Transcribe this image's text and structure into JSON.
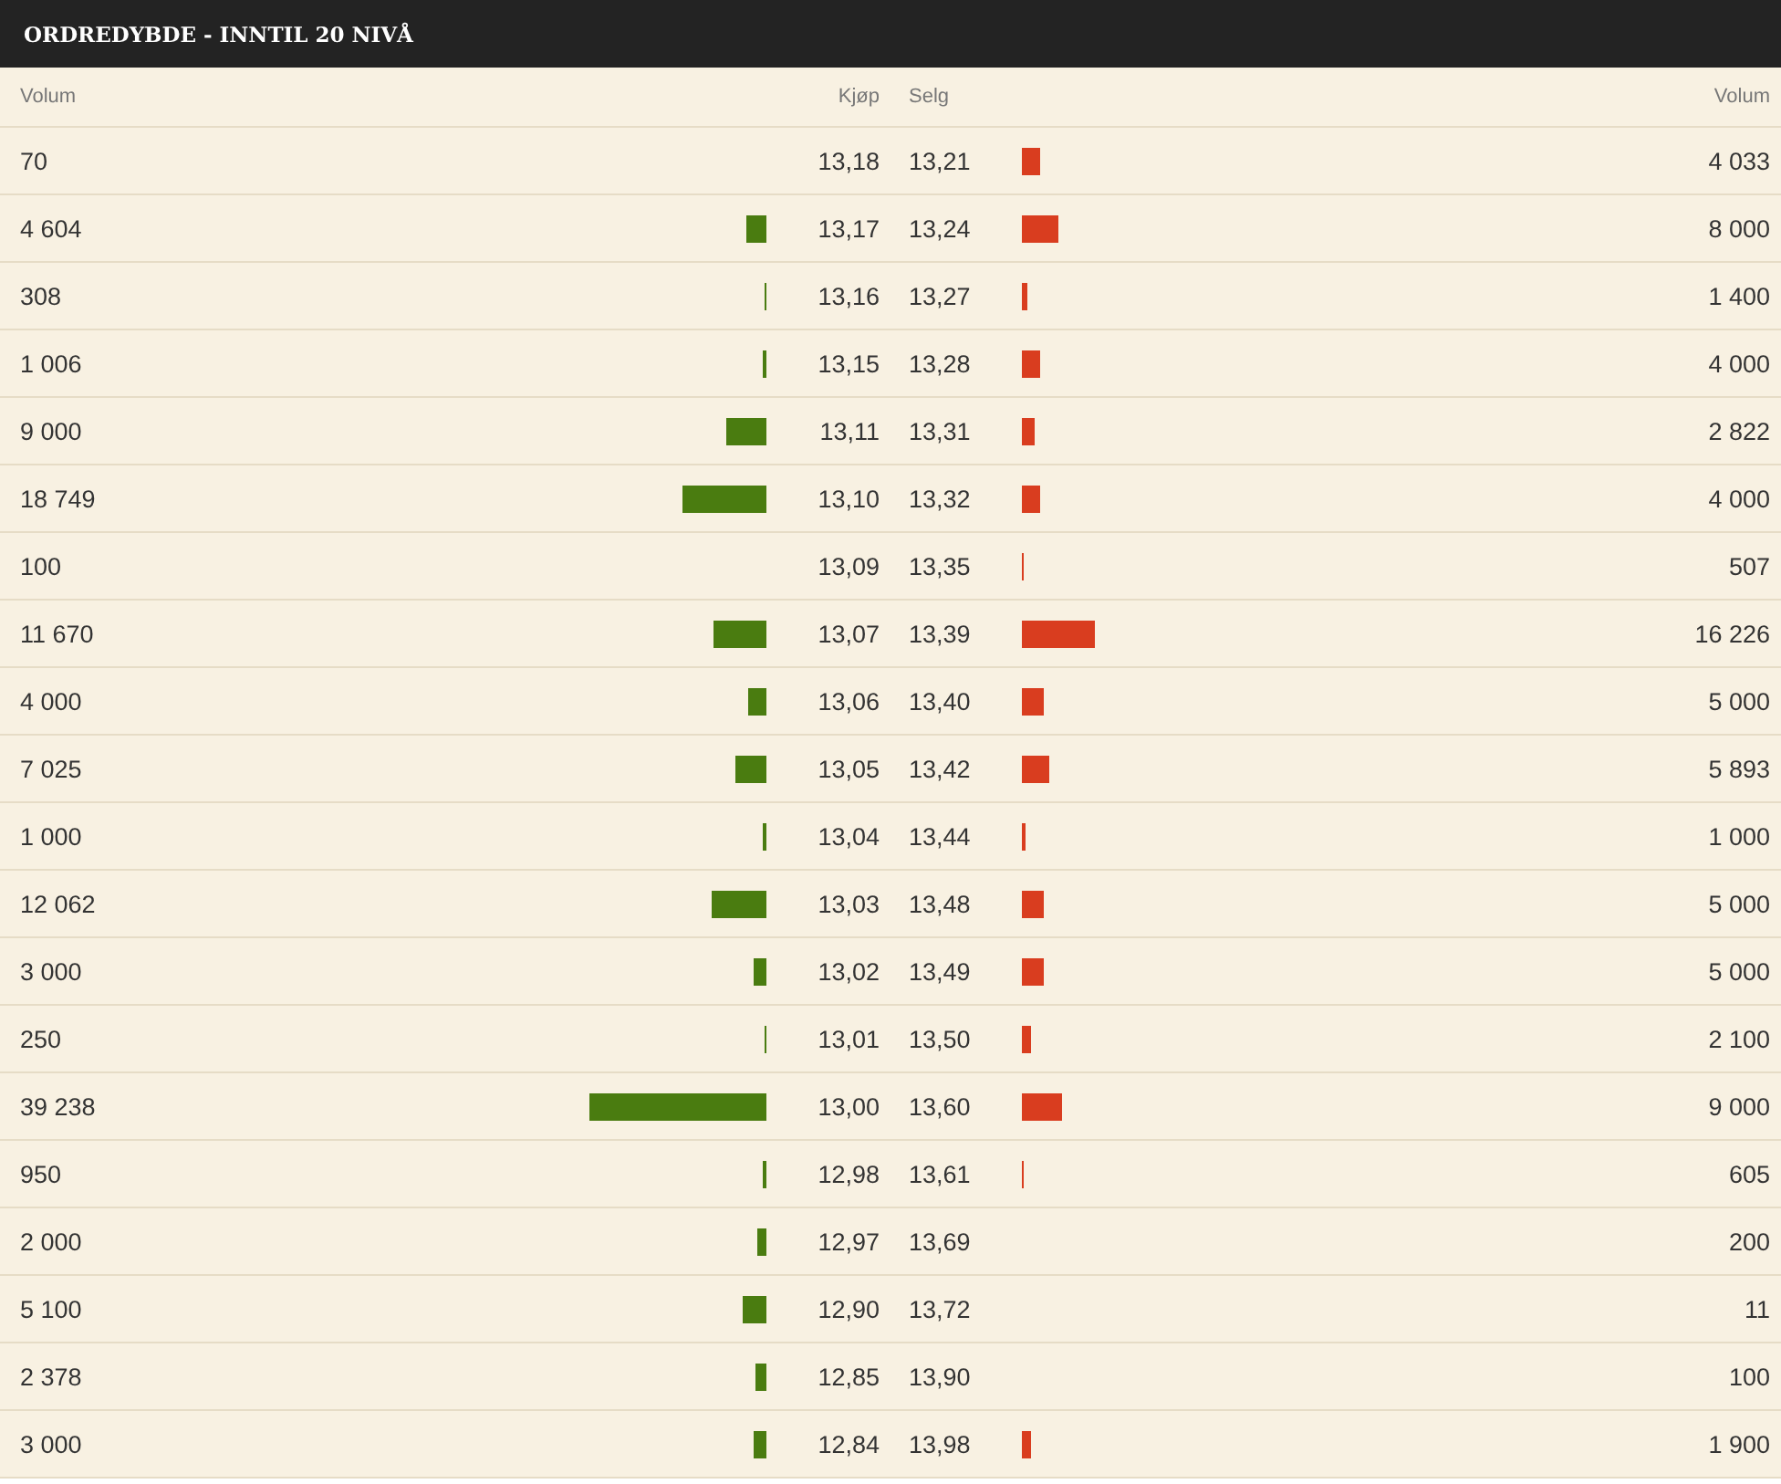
{
  "title": "ORDREDYBDE - INNTIL 20 NIVÅ",
  "columns": [
    "Volum",
    "Kjøp",
    "Selg",
    "Volum"
  ],
  "rows": [
    {
      "bid": {
        "volume": "70",
        "price": "13,18"
      },
      "ask": {
        "price": "13,21",
        "level": 0.1,
        "volume": "4 033"
      }
    },
    {
      "bid": {
        "volume": "4 604",
        "level": 0.11,
        "price": "13,17"
      },
      "ask": {
        "price": "13,24",
        "level": 0.2,
        "volume": "8 000"
      }
    },
    {
      "bid": {
        "volume": "308",
        "level": 0.01,
        "price": "13,16"
      },
      "ask": {
        "price": "13,27",
        "level": 0.03,
        "volume": "1 400"
      }
    },
    {
      "bid": {
        "volume": "1 006",
        "level": 0.02,
        "price": "13,15"
      },
      "ask": {
        "price": "13,28",
        "level": 0.1,
        "volume": "4 000"
      }
    },
    {
      "bid": {
        "volume": "9 000",
        "level": 0.22,
        "price": "13,11"
      },
      "ask": {
        "price": "13,31",
        "level": 0.07,
        "volume": "2 822"
      }
    },
    {
      "bid": {
        "volume": "18 749",
        "level": 0.46,
        "price": "13,10"
      },
      "ask": {
        "price": "13,32",
        "level": 0.1,
        "volume": "4 000"
      }
    },
    {
      "bid": {
        "volume": "100",
        "price": "13,09"
      },
      "ask": {
        "price": "13,35",
        "level": 0.01,
        "volume": "507"
      }
    },
    {
      "bid": {
        "volume": "11 670",
        "level": 0.29,
        "price": "13,07"
      },
      "ask": {
        "price": "13,39",
        "level": 0.4,
        "volume": "16 226"
      }
    },
    {
      "bid": {
        "volume": "4 000",
        "level": 0.1,
        "price": "13,06"
      },
      "ask": {
        "price": "13,40",
        "level": 0.12,
        "volume": "5 000"
      }
    },
    {
      "bid": {
        "volume": "7 025",
        "level": 0.17,
        "price": "13,05"
      },
      "ask": {
        "price": "13,42",
        "level": 0.15,
        "volume": "5 893"
      }
    },
    {
      "bid": {
        "volume": "1 000",
        "level": 0.02,
        "price": "13,04"
      },
      "ask": {
        "price": "13,44",
        "level": 0.02,
        "volume": "1 000"
      }
    },
    {
      "bid": {
        "volume": "12 062",
        "level": 0.3,
        "price": "13,03"
      },
      "ask": {
        "price": "13,48",
        "level": 0.12,
        "volume": "5 000"
      }
    },
    {
      "bid": {
        "volume": "3 000",
        "level": 0.07,
        "price": "13,02"
      },
      "ask": {
        "price": "13,49",
        "level": 0.12,
        "volume": "5 000"
      }
    },
    {
      "bid": {
        "volume": "250",
        "level": 0.01,
        "price": "13,01"
      },
      "ask": {
        "price": "13,50",
        "level": 0.05,
        "volume": "2 100"
      }
    },
    {
      "bid": {
        "volume": "39 238",
        "level": 0.97,
        "price": "13,00"
      },
      "ask": {
        "price": "13,60",
        "level": 0.22,
        "volume": "9 000"
      }
    },
    {
      "bid": {
        "volume": "950",
        "level": 0.02,
        "price": "12,98"
      },
      "ask": {
        "price": "13,61",
        "level": 0.01,
        "volume": "605"
      }
    },
    {
      "bid": {
        "volume": "2 000",
        "level": 0.05,
        "price": "12,97"
      },
      "ask": {
        "price": "13,69",
        "volume": "200"
      }
    },
    {
      "bid": {
        "volume": "5 100",
        "level": 0.13,
        "price": "12,90"
      },
      "ask": {
        "price": "13,72",
        "volume": "11"
      }
    },
    {
      "bid": {
        "volume": "2 378",
        "level": 0.06,
        "price": "12,85"
      },
      "ask": {
        "price": "13,90",
        "volume": "100"
      }
    },
    {
      "bid": {
        "volume": "3 000",
        "level": 0.07,
        "price": "12,84"
      },
      "ask": {
        "price": "13,98",
        "level": 0.05,
        "volume": "1 900"
      }
    }
  ]
}
